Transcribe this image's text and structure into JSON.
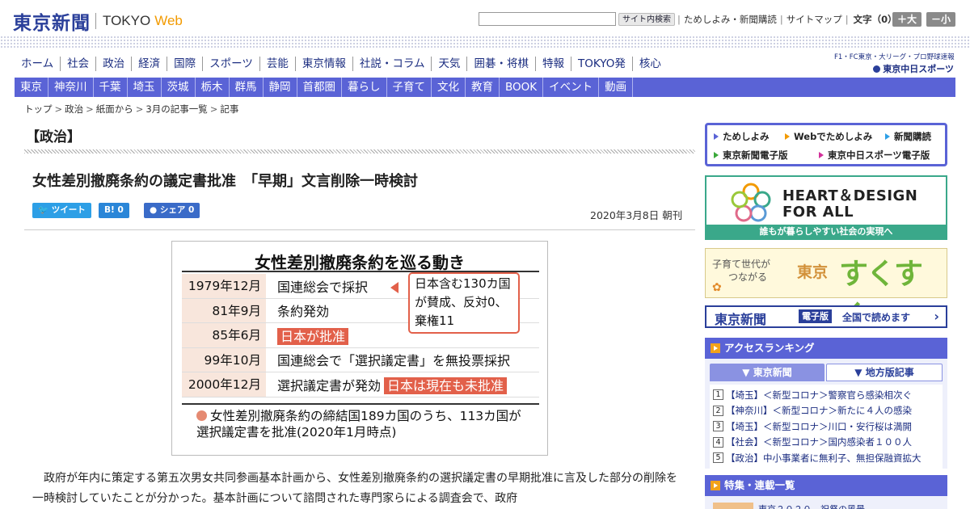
{
  "header": {
    "logo_kanji": "東京新聞",
    "logo_tokyo": "TOKYO",
    "logo_web": "Web",
    "search_button": "サイト内検索",
    "util_links": [
      "ためしよみ・新聞購読",
      "サイトマップ"
    ],
    "font_size_label": "文字（0）",
    "font_larger": "＋大",
    "font_smaller": "－小"
  },
  "main_nav": [
    "ホーム",
    "社会",
    "政治",
    "経済",
    "国際",
    "スポーツ",
    "芸能",
    "東京情報",
    "社説・コラム",
    "天気",
    "囲碁・将棋",
    "特報",
    "TOKYO発",
    "核心"
  ],
  "sports_link": {
    "sub": "F1・FC東京・大リーグ・プロ野球速報",
    "name": "東京中日スポーツ"
  },
  "region_nav": [
    "東京",
    "神奈川",
    "千葉",
    "埼玉",
    "茨城",
    "栃木",
    "群馬",
    "静岡",
    "首都圏",
    "暮らし",
    "子育て",
    "文化",
    "教育",
    "BOOK",
    "イベント",
    "動画"
  ],
  "breadcrumb": [
    "トップ",
    "政治",
    "紙面から",
    "3月の記事一覧",
    "記事"
  ],
  "section_title": "【政治】",
  "article": {
    "title": "女性差別撤廃条約の議定書批准　「早期」文言削除一時検討",
    "share_tweet": "ツイート",
    "share_hatena": "B! 0",
    "share_fb": "シェア 0",
    "date": "2020年3月8日 朝刊",
    "body": "政府が年内に策定する第五次男女共同参画基本計画から、女性差別撤廃条約の選択議定書の早期批准に言及した部分の削除を一時検討していたことが分かった。基本計画について諮問された専門家らによる調査会で、政府"
  },
  "figure": {
    "title": "女性差別撤廃条約を巡る動き",
    "rows": [
      {
        "year": "1979年12月",
        "event": "国連総会で採択",
        "highlight": "",
        "badge": ""
      },
      {
        "year": "81年9月",
        "event": "条約発効",
        "highlight": "",
        "badge": ""
      },
      {
        "year": "85年6月",
        "event": "",
        "highlight": "日本が批准",
        "badge": ""
      },
      {
        "year": "99年10月",
        "event": "国連総会で「選択議定書」を無投票採択",
        "highlight": "",
        "badge": ""
      },
      {
        "year": "2000年12月",
        "event": "選択議定書が発効",
        "highlight": "",
        "badge": "日本は現在も未批准"
      }
    ],
    "callout": "日本含む130カ国が賛成、反対0、棄権11",
    "note": "女性差別撤廃条約の締結国189カ国のうち、113カ国が選択議定書を批准(2020年1月時点)"
  },
  "sidebar": {
    "quick_links": [
      "ためしよみ",
      "Webでためしよみ",
      "新聞購読",
      "東京新聞電子版",
      "東京中日スポーツ電子版"
    ],
    "heart_design": {
      "line1": "HEART＆DESIGN",
      "line2": "FOR ALL",
      "caption": "誰もが暮らしやすい社会の実現へ"
    },
    "sukusuku": {
      "tagline1": "子育て世代が",
      "tagline2": "つながる",
      "city": "東京",
      "logo": "すくすく"
    },
    "e_edition": {
      "name": "東京新聞",
      "badge": "電子版",
      "text": "全国で読めます"
    },
    "ranking": {
      "title": "アクセスランキング",
      "tab_tokyo": "東京新聞",
      "tab_local": "地方版記事",
      "items": [
        "【埼玉】＜新型コロナ＞警察官ら感染相次ぐ",
        "【神奈川】＜新型コロナ＞新たに４人の感染",
        "【埼玉】＜新型コロナ＞川口・安行桜は満開",
        "【社会】＜新型コロナ＞国内感染者１００人",
        "【政治】中小事業者に無利子、無担保融資拡大"
      ]
    },
    "special": {
      "title": "特集・連載一覧",
      "teaser": "東京２０２０　祝祭の風景"
    }
  }
}
